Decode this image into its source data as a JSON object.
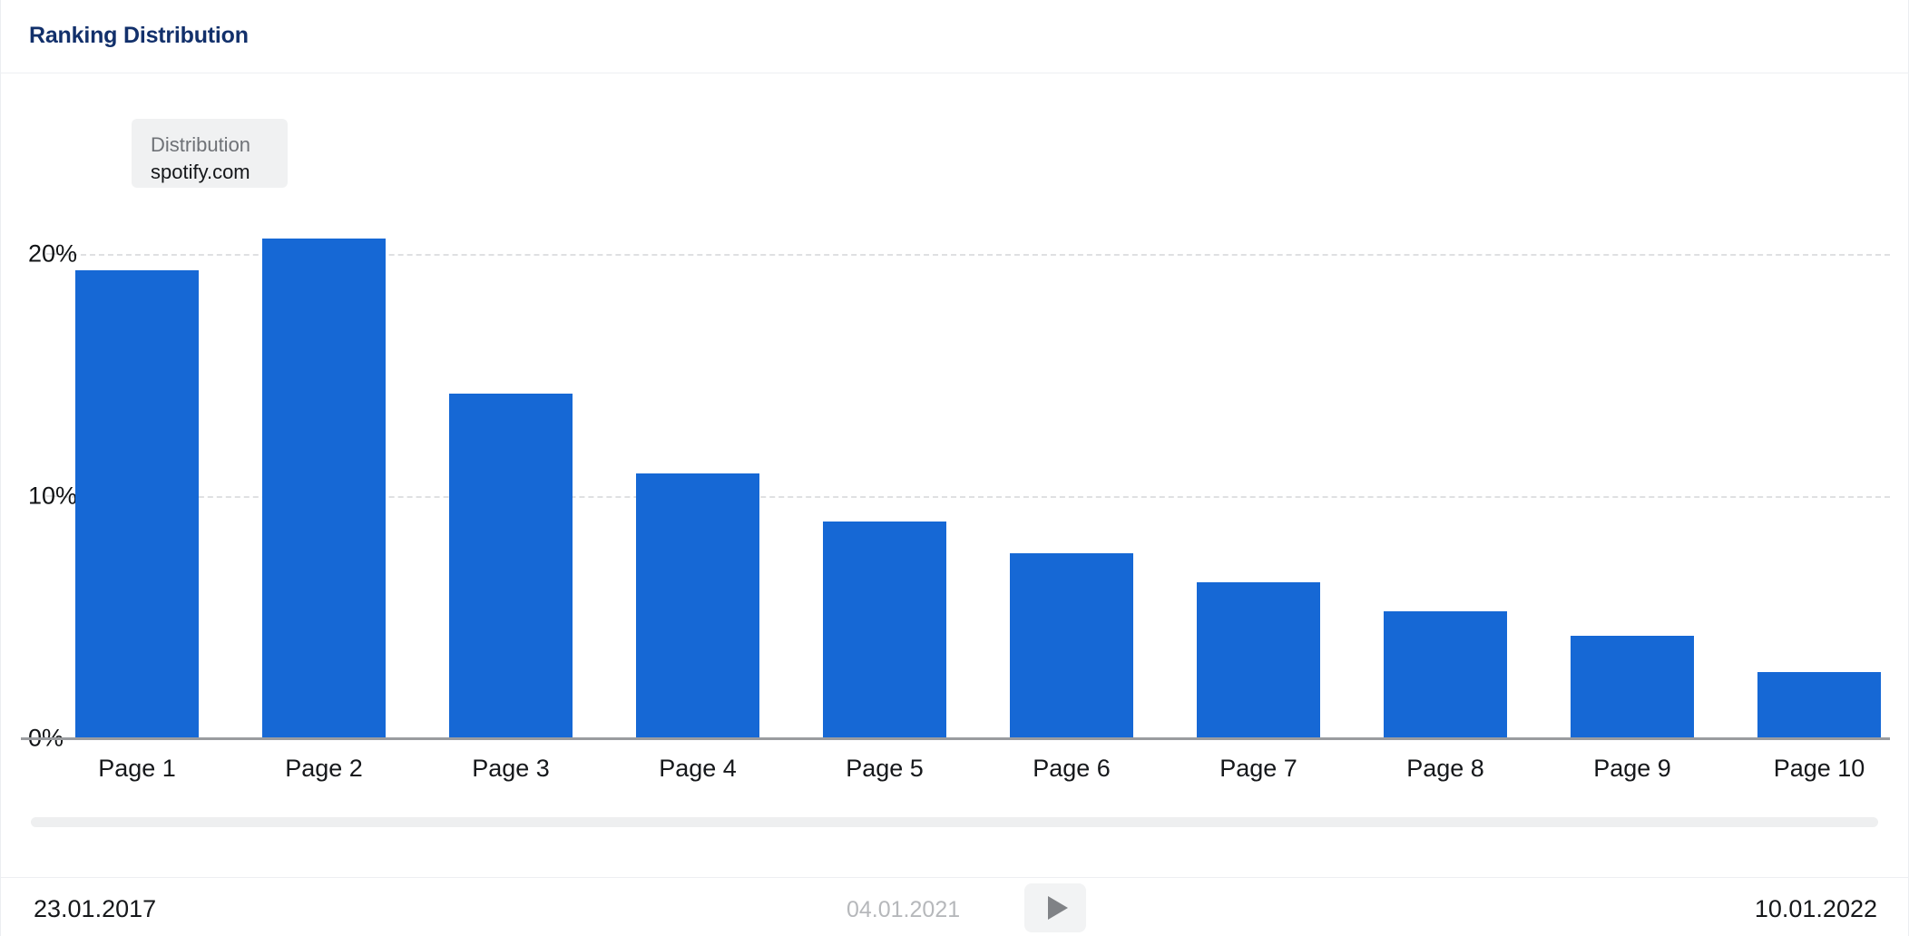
{
  "header": {
    "title": "Ranking Distribution"
  },
  "tooltip": {
    "series_label": "Distribution",
    "value_label": "spotify.com"
  },
  "footer": {
    "start_date": "23.01.2017",
    "current_date": "04.01.2021",
    "end_date": "10.01.2022",
    "play_icon": "play-icon"
  },
  "colors": {
    "bar": "#1668d5",
    "title": "#12306b",
    "gridline": "#dfe0e2",
    "axis": "#9a9c9f",
    "tooltip_bg": "#f0f1f2"
  },
  "chart_data": {
    "type": "bar",
    "title": "Ranking Distribution",
    "xlabel": "",
    "ylabel": "",
    "categories": [
      "Page 1",
      "Page 2",
      "Page 3",
      "Page 4",
      "Page 5",
      "Page 6",
      "Page 7",
      "Page 8",
      "Page 9",
      "Page 10"
    ],
    "values": [
      19.3,
      20.6,
      14.2,
      10.9,
      8.9,
      7.6,
      6.4,
      5.2,
      4.2,
      2.7
    ],
    "series": [
      {
        "name": "Distribution",
        "values": [
          19.3,
          20.6,
          14.2,
          10.9,
          8.9,
          7.6,
          6.4,
          5.2,
          4.2,
          2.7
        ]
      }
    ],
    "ytick_labels": [
      "0%",
      "10%",
      "20%"
    ],
    "ytick_values": [
      0,
      10,
      20
    ],
    "ylim": [
      0,
      22
    ],
    "grid": true,
    "legend_position": "top-left",
    "unit": "%"
  }
}
